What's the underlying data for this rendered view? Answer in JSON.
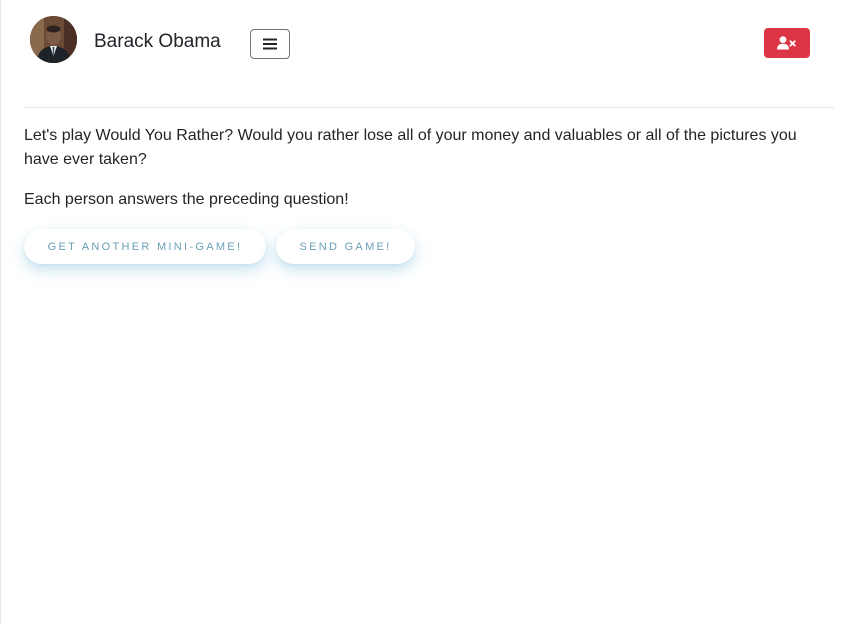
{
  "header": {
    "user_name": "Barack Obama",
    "menu_icon": "hamburger-icon",
    "remove_friend_icon": "user-times-icon",
    "remove_friend_color": "#dc3545"
  },
  "main": {
    "question": "Let's play Would You Rather? Would you rather lose all of your money and valuables or all of the pictures you have ever taken?",
    "instruction": "Each person answers the preceding question!",
    "buttons": {
      "another_label": "GET ANOTHER MINI-GAME!",
      "send_label": "SEND GAME!"
    },
    "button_text_color": "#6a9fb5"
  }
}
